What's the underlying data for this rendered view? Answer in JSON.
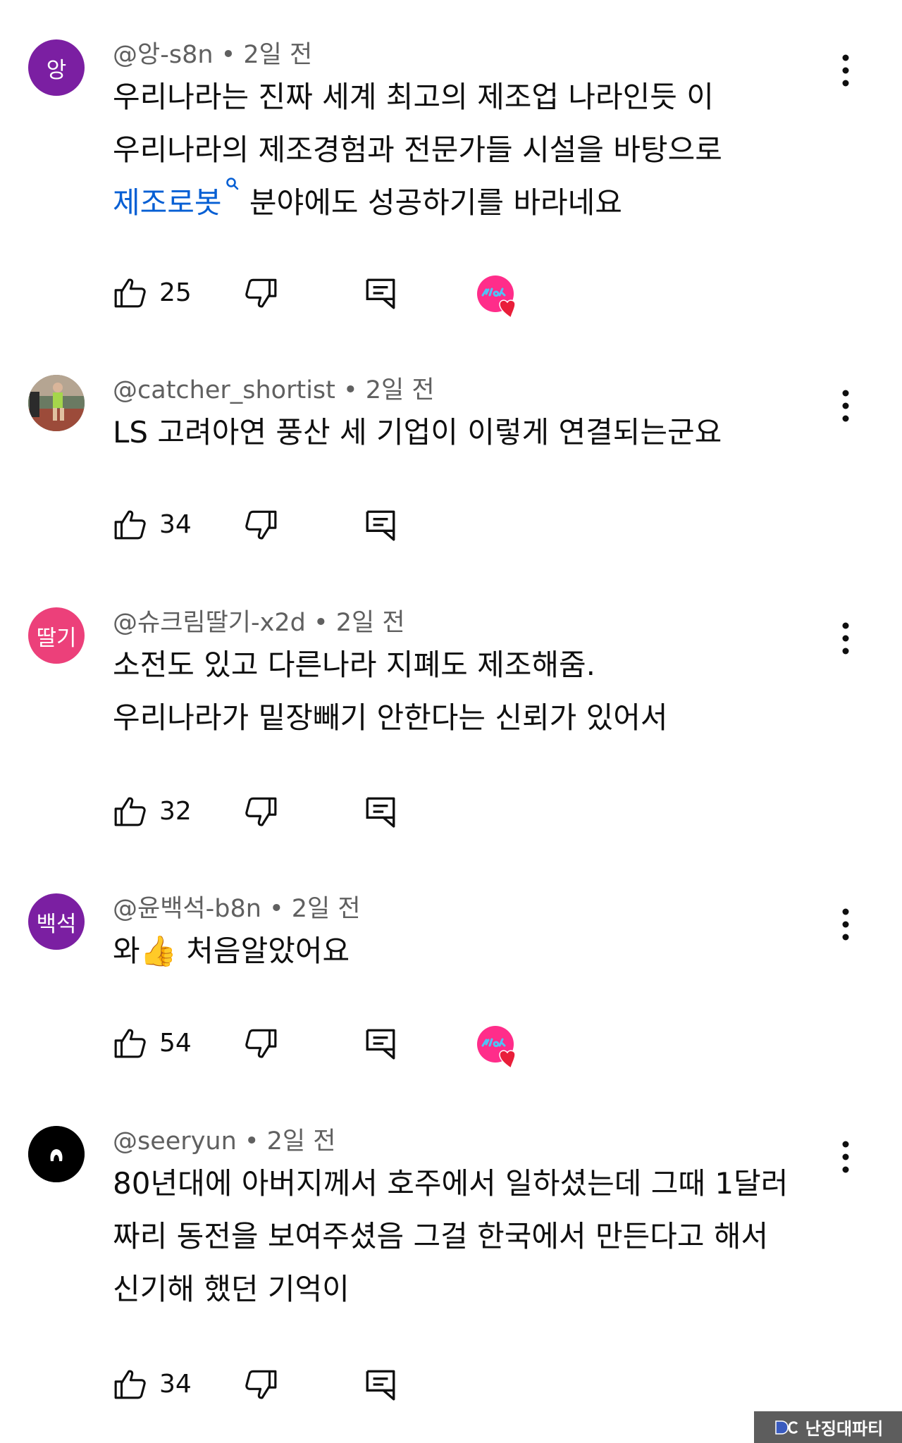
{
  "comments": [
    {
      "avatar_text": "앙",
      "avatar_color": "#7b1fa2",
      "meta": "@앙-s8n • 2일 전",
      "lines": [
        "우리나라는 진짜 세계 최고의 제조업 나라인듯 이",
        "우리나라의 제조경험과 전문가들 시설을 바탕으로"
      ],
      "link_text": "제조로봇",
      "link_after": " 분야에도 성공하기를 바라네요",
      "likes": "25",
      "creator_heart": true
    },
    {
      "avatar_text": "",
      "avatar_color": "#8a6f5c",
      "meta": "@catcher_shortist • 2일 전",
      "lines": [
        "LS 고려아연 풍산 세 기업이 이렇게 연결되는군요"
      ],
      "likes": "34",
      "creator_heart": false
    },
    {
      "avatar_text": "딸기",
      "avatar_color": "#ec407a",
      "meta": "@슈크림딸기-x2d • 2일 전",
      "lines": [
        "소전도 있고 다른나라 지폐도 제조해줌.",
        "우리나라가 밑장빼기 안한다는 신뢰가 있어서"
      ],
      "likes": "32",
      "creator_heart": false
    },
    {
      "avatar_text": "백석",
      "avatar_color": "#7b1fa2",
      "meta": "@윤백석-b8n • 2일 전",
      "lines": [
        "와👍  처음알았어요"
      ],
      "likes": "54",
      "creator_heart": true
    },
    {
      "avatar_text": "",
      "avatar_color": "#000000",
      "meta": "@seeryun • 2일 전",
      "lines": [
        "80년대에 아버지께서 호주에서 일하셨는데 그때 1달러",
        "짜리 동전을 보여주셨음 그걸 한국에서 만든다고 해서",
        "신기해 했던 기억이"
      ],
      "likes": "34",
      "creator_heart": false
    }
  ],
  "icons": {
    "like": "thumbs-up-icon",
    "dislike": "thumbs-down-icon",
    "reply": "reply-icon",
    "more": "more-vert-icon",
    "search": "search-icon"
  },
  "colors": {
    "link": "#065fd4",
    "meta": "#606060",
    "heart": "#e91e3a",
    "badge": "#ff2d8a"
  },
  "watermark": {
    "logo": "dc",
    "text": "난징대파티"
  }
}
